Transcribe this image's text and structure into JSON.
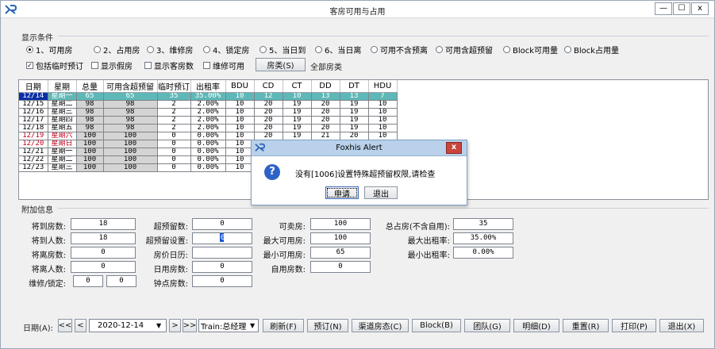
{
  "window": {
    "title": "客房可用与占用",
    "buttons": [
      "—",
      "☐",
      "x"
    ]
  },
  "display_conditions": {
    "label": "显示条件",
    "radios": [
      {
        "label": "1、可用房",
        "checked": true
      },
      {
        "label": "2、占用房",
        "checked": false
      },
      {
        "label": "3、维修房",
        "checked": false
      },
      {
        "label": "4、锁定房",
        "checked": false
      },
      {
        "label": "5、当日到",
        "checked": false
      },
      {
        "label": "6、当日离",
        "checked": false
      },
      {
        "label": "可用不含预离",
        "checked": false
      },
      {
        "label": "可用含超预留",
        "checked": false
      },
      {
        "label": "Block可用量",
        "checked": false
      },
      {
        "label": "Block占用量",
        "checked": false
      }
    ],
    "checkboxes": [
      {
        "label": "包括临时预订",
        "checked": true
      },
      {
        "label": "显示假房",
        "checked": false
      },
      {
        "label": "显示客房数",
        "checked": false
      },
      {
        "label": "维修可用",
        "checked": false
      }
    ],
    "room_type_button": "房类(S)",
    "room_type_value": "全部房类"
  },
  "grid": {
    "columns": [
      "日期",
      "星期",
      "总量",
      "可用含超预留",
      "临时预订",
      "出租率",
      "BDU",
      "CD",
      "CT",
      "DD",
      "DT",
      "HDU"
    ],
    "rows": [
      {
        "date": "12/14",
        "week": "星期一",
        "total": "65",
        "avail": "65",
        "temp": "35",
        "rate": "35.00%",
        "bdu": "10",
        "cd": "12",
        "ct": "10",
        "dd": "13",
        "dt": "13",
        "hdu": "7",
        "selected": true,
        "weekend": false
      },
      {
        "date": "12/15",
        "week": "星期二",
        "total": "98",
        "avail": "98",
        "temp": "2",
        "rate": "2.00%",
        "bdu": "10",
        "cd": "20",
        "ct": "19",
        "dd": "20",
        "dt": "19",
        "hdu": "10",
        "selected": false,
        "weekend": false
      },
      {
        "date": "12/16",
        "week": "星期三",
        "total": "98",
        "avail": "98",
        "temp": "2",
        "rate": "2.00%",
        "bdu": "10",
        "cd": "20",
        "ct": "19",
        "dd": "20",
        "dt": "19",
        "hdu": "10",
        "selected": false,
        "weekend": false
      },
      {
        "date": "12/17",
        "week": "星期四",
        "total": "98",
        "avail": "98",
        "temp": "2",
        "rate": "2.00%",
        "bdu": "10",
        "cd": "20",
        "ct": "19",
        "dd": "20",
        "dt": "19",
        "hdu": "10",
        "selected": false,
        "weekend": false
      },
      {
        "date": "12/18",
        "week": "星期五",
        "total": "98",
        "avail": "98",
        "temp": "2",
        "rate": "2.00%",
        "bdu": "10",
        "cd": "20",
        "ct": "19",
        "dd": "20",
        "dt": "19",
        "hdu": "10",
        "selected": false,
        "weekend": false
      },
      {
        "date": "12/19",
        "week": "星期六",
        "total": "100",
        "avail": "100",
        "temp": "0",
        "rate": "0.00%",
        "bdu": "10",
        "cd": "20",
        "ct": "19",
        "dd": "21",
        "dt": "20",
        "hdu": "10",
        "selected": false,
        "weekend": true
      },
      {
        "date": "12/20",
        "week": "星期日",
        "total": "100",
        "avail": "100",
        "temp": "0",
        "rate": "0.00%",
        "bdu": "10",
        "cd": "",
        "ct": "",
        "dd": "",
        "dt": "",
        "hdu": "",
        "selected": false,
        "weekend": true
      },
      {
        "date": "12/21",
        "week": "星期一",
        "total": "100",
        "avail": "100",
        "temp": "0",
        "rate": "0.00%",
        "bdu": "10",
        "cd": "",
        "ct": "",
        "dd": "",
        "dt": "",
        "hdu": "",
        "selected": false,
        "weekend": false
      },
      {
        "date": "12/22",
        "week": "星期二",
        "total": "100",
        "avail": "100",
        "temp": "0",
        "rate": "0.00%",
        "bdu": "10",
        "cd": "",
        "ct": "",
        "dd": "",
        "dt": "",
        "hdu": "",
        "selected": false,
        "weekend": false
      },
      {
        "date": "12/23",
        "week": "星期三",
        "total": "100",
        "avail": "100",
        "temp": "0",
        "rate": "0.00%",
        "bdu": "10",
        "cd": "",
        "ct": "",
        "dd": "",
        "dt": "",
        "hdu": "",
        "selected": false,
        "weekend": false
      }
    ]
  },
  "additional": {
    "label": "附加信息",
    "arrive_rooms_label": "将到房数:",
    "arrive_rooms": "18",
    "arrive_people_label": "将到人数:",
    "arrive_people": "18",
    "depart_rooms_label": "将离房数:",
    "depart_rooms": "0",
    "depart_people_label": "将离人数:",
    "depart_people": "0",
    "repair_lock_label": "维修/锁定:",
    "repair": "0",
    "lock": "0",
    "over_reserve_label": "超预留数:",
    "over_reserve": "0",
    "over_setting_label": "超预留设置:",
    "over_setting": "0",
    "price_calendar_label": "房价日历:",
    "price_calendar": "",
    "day_use_label": "日用房数:",
    "day_use": "0",
    "hourly_label": "钟点房数:",
    "hourly": "0",
    "sellable_label": "可卖房:",
    "sellable": "100",
    "max_avail_label": "最大可用房:",
    "max_avail": "100",
    "min_avail_label": "最小可用房:",
    "min_avail": "65",
    "self_use_label": "自用房数:",
    "self_use": "0",
    "total_occ_label": "总占房(不含自用):",
    "total_occ": "35",
    "max_rate_label": "最大出租率:",
    "max_rate": "35.00%",
    "min_rate_label": "最小出租率:",
    "min_rate": "0.00%"
  },
  "footer": {
    "date_label": "日期(A):",
    "nav_first": "<<",
    "nav_prev": "<",
    "nav_next": ">",
    "nav_last": ">>",
    "date_value": "2020-12-14",
    "train_value": "Train:总经理",
    "buttons": [
      "刷新(F)",
      "预订(N)",
      "渠道房态(C)",
      "Block(B)",
      "团队(G)",
      "明细(D)",
      "重置(R)",
      "打印(P)",
      "退出(X)"
    ]
  },
  "dialog": {
    "title": "Foxhis Alert",
    "message": "没有[1006]设置特殊超预留权限,请检查",
    "ok_button": "申请",
    "cancel_button": "退出",
    "close": "x"
  }
}
